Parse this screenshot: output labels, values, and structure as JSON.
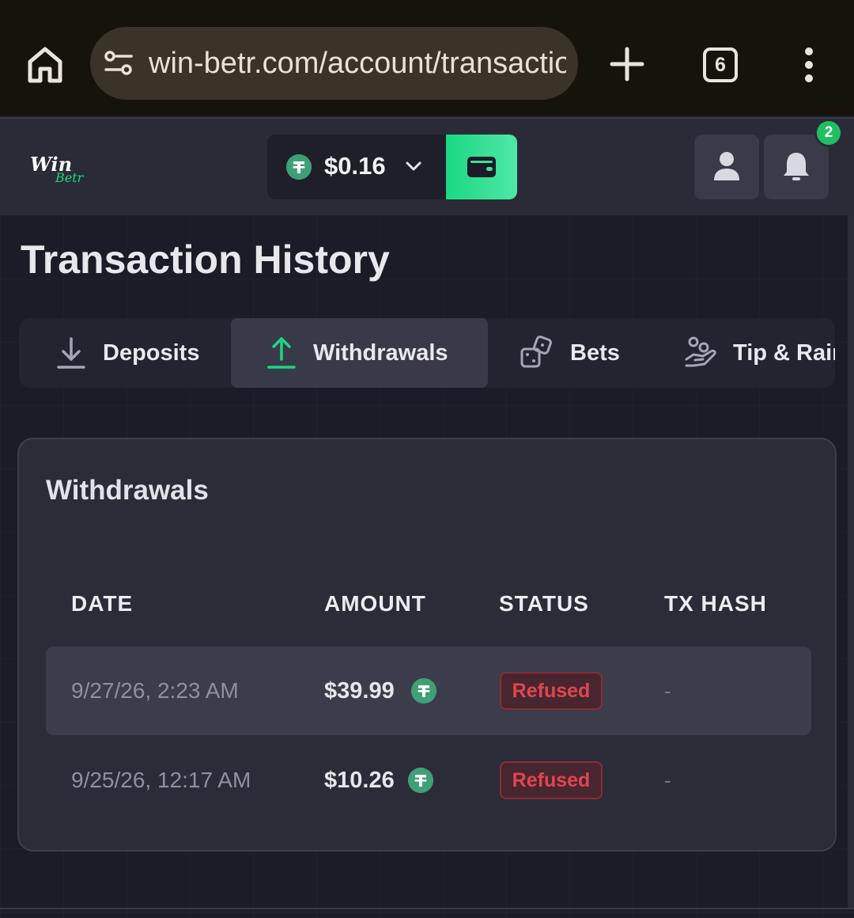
{
  "browser": {
    "url": "win-betr.com/account/transactions",
    "tab_count": "6"
  },
  "header": {
    "logo_text": "WinBetr",
    "balance": "$0.16",
    "notification_count": "2",
    "colors": {
      "accent": "#1ad882",
      "coin": "#3f9f77",
      "badge": "#1fbf61"
    }
  },
  "page": {
    "title": "Transaction History"
  },
  "tabs": [
    {
      "label": "Deposits",
      "icon": "download-icon",
      "active": false
    },
    {
      "label": "Withdrawals",
      "icon": "upload-icon",
      "active": true
    },
    {
      "label": "Bets",
      "icon": "dice-icon",
      "active": false
    },
    {
      "label": "Tip & Rain",
      "icon": "hand-coins-icon",
      "active": false
    }
  ],
  "withdrawals": {
    "title": "Withdrawals",
    "columns": [
      "DATE",
      "AMOUNT",
      "STATUS",
      "TX HASH"
    ],
    "rows": [
      {
        "date": "9/27/26, 2:23 AM",
        "amount": "$39.99",
        "status": "Refused",
        "tx_hash": "-"
      },
      {
        "date": "9/25/26, 12:17 AM",
        "amount": "$10.26",
        "status": "Refused",
        "tx_hash": "-"
      }
    ],
    "status_color": "#e1454f"
  }
}
